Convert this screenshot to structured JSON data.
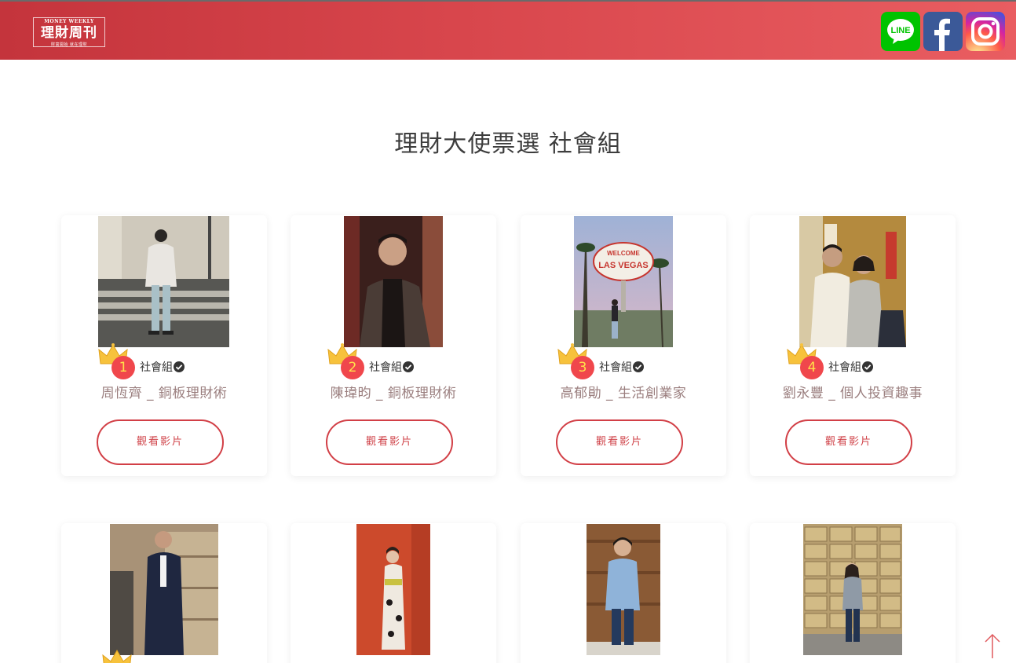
{
  "header": {
    "logo": {
      "en": "MONEY WEEKLY",
      "cn": "理財周刊",
      "sub": "財富開始 就在理財"
    },
    "social": [
      {
        "name": "line",
        "label": "LINE",
        "color": "#00c300"
      },
      {
        "name": "facebook",
        "label": "f",
        "color": "#3b5998"
      },
      {
        "name": "instagram",
        "label": "",
        "color": "#d6249f"
      }
    ]
  },
  "page": {
    "title": "理財大使票選 社會組"
  },
  "candidates": [
    {
      "rank": "1",
      "group": "社會組",
      "name": "周恆齊 _ 銅板理財術",
      "button": "觀看影片"
    },
    {
      "rank": "2",
      "group": "社會組",
      "name": "陳瑋昀 _ 銅板理財術",
      "button": "觀看影片"
    },
    {
      "rank": "3",
      "group": "社會組",
      "name": "高郁勛 _ 生活創業家",
      "button": "觀看影片"
    },
    {
      "rank": "4",
      "group": "社會組",
      "name": "劉永豐 _ 個人投資趣事",
      "button": "觀看影片"
    }
  ],
  "icons": {
    "back_to_top": "arrow-up-icon",
    "verified": "check-circle-icon",
    "crown": "crown-icon"
  },
  "colors": {
    "brand": "#d23f46",
    "rank_badge": "#f0474c",
    "rank_text": "#ffe14a"
  }
}
